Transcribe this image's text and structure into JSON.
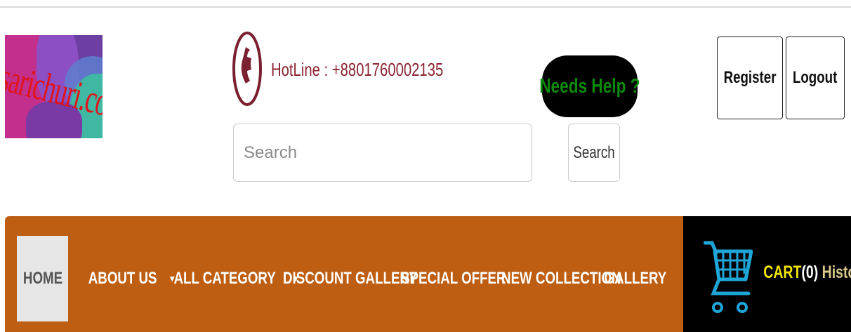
{
  "brand": {
    "logo_text": "sarichuri.com"
  },
  "hotline": {
    "text": "HotLine : +8801760002135",
    "color": "#8b2430"
  },
  "help": {
    "label": "Needs Help ?",
    "color": "#0a8a0a"
  },
  "search": {
    "placeholder": "Search",
    "button_label": "Search"
  },
  "auth": {
    "register_label": "Register",
    "logout_label": "Logout"
  },
  "nav": {
    "background": "#be5e12",
    "items": [
      {
        "label": "HOME",
        "active": true
      },
      {
        "label": "ABOUT US",
        "dropdown": true
      },
      {
        "label": "ALL CATEGORY",
        "dropdown": true
      },
      {
        "label": "DISCOUNT GALLERY"
      },
      {
        "label": "SPECIAL OFFER"
      },
      {
        "label": "NEW COLLECTION"
      },
      {
        "label": "GALLERY"
      }
    ]
  },
  "cart": {
    "label": "CART",
    "count": "(0)",
    "history_label": "History",
    "icon": "shopping-cart-icon"
  }
}
